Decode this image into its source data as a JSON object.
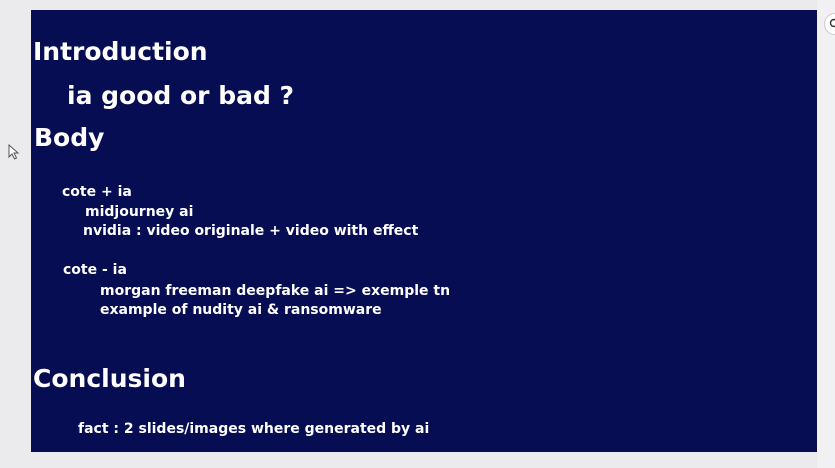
{
  "slide": {
    "background": "#060d52",
    "text_color": "#ffffff",
    "intro_heading": "Introduction",
    "intro_sub": "ia good or bad ?",
    "body_heading": "Body",
    "pro_title": "cote + ia",
    "pro_items": [
      "midjourney ai",
      "nvidia : video originale + video with effect"
    ],
    "con_title": "cote - ia",
    "con_items": [
      "morgan freeman deepfake ai => exemple tn",
      "example of nudity ai & ransomware"
    ],
    "conclusion_heading": "Conclusion",
    "conclusion_text": "fact : 2 slides/images where generated by ai"
  },
  "icons": {
    "cursor": "mouse-pointer-icon",
    "zoom": "zoom-icon"
  }
}
